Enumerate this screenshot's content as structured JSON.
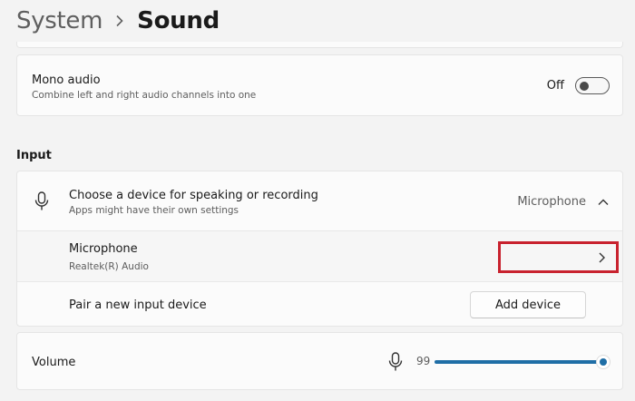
{
  "breadcrumb": {
    "parent": "System",
    "separator_icon": "chevron-right-icon",
    "current": "Sound"
  },
  "mono_audio": {
    "title": "Mono audio",
    "description": "Combine left and right audio channels into one",
    "toggle_state_label": "Off",
    "toggle_on": false
  },
  "input_section": {
    "heading": "Input",
    "choose_device": {
      "icon": "microphone-icon",
      "title": "Choose a device for speaking or recording",
      "description": "Apps might have their own settings",
      "selected_value": "Microphone",
      "expand_icon": "chevron-up-icon"
    },
    "device": {
      "name": "Microphone",
      "detail": "Realtek(R) Audio",
      "nav_icon": "chevron-right-icon"
    },
    "pair": {
      "label": "Pair a new input device",
      "button_label": "Add device"
    }
  },
  "volume": {
    "label": "Volume",
    "icon": "microphone-icon",
    "value_text": "99",
    "level_percent": 99
  },
  "colors": {
    "accent": "#1f6ea6",
    "highlight": "#c8222e",
    "background": "#f3f3f3",
    "card": "#fbfbfb"
  }
}
